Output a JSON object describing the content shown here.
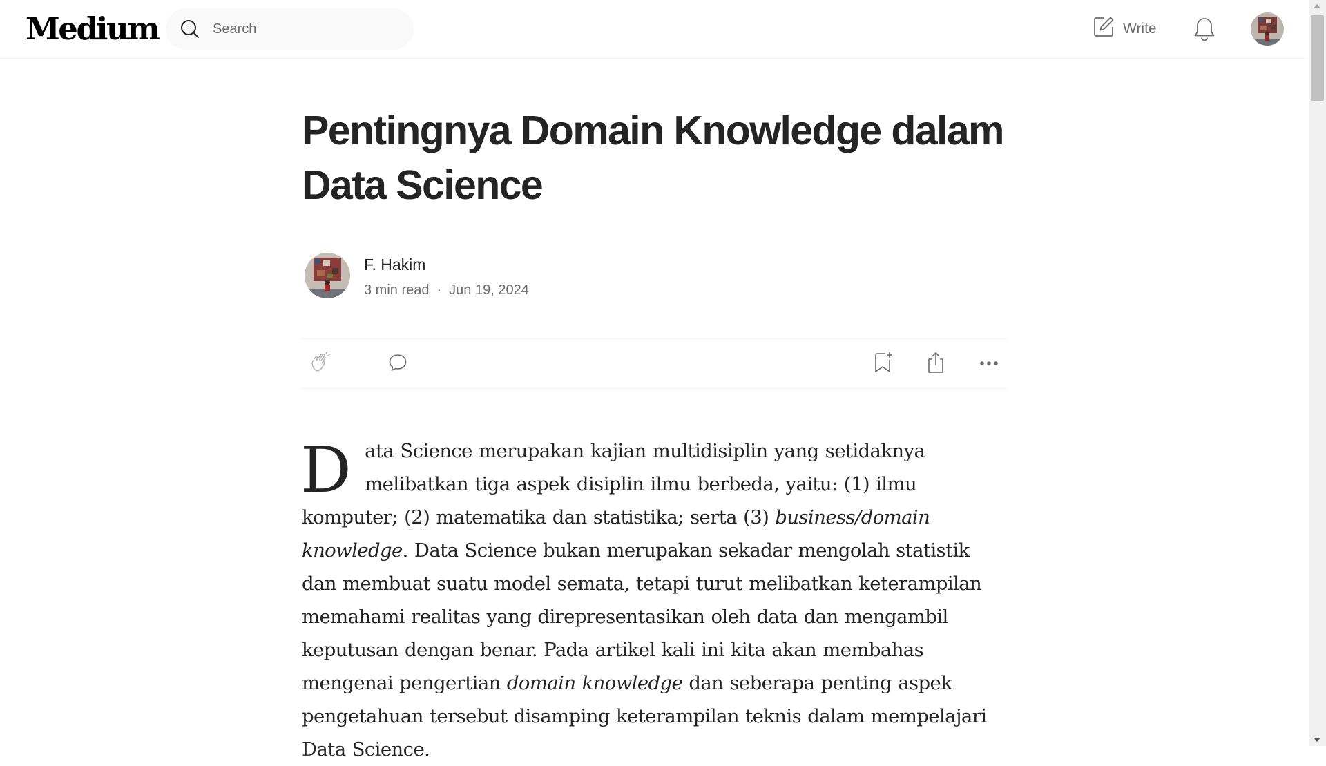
{
  "header": {
    "logo": "Medium",
    "search_placeholder": "Search",
    "write_label": "Write"
  },
  "article": {
    "title": "Pentingnya Domain Knowledge dalam Data Science",
    "author": "F. Hakim",
    "read_time": "3 min read",
    "separator": "·",
    "date": "Jun 19, 2024",
    "dropcap": "D",
    "paragraph": [
      {
        "text": "ata Science merupakan kajian multidisiplin yang setidaknya melibatkan tiga aspek disiplin ilmu berbeda, yaitu: (1) ilmu komputer; (2) matematika dan statistika; serta (3) ",
        "italic": false
      },
      {
        "text": "business/domain knowledge",
        "italic": true
      },
      {
        "text": ". Data Science bukan merupakan sekadar mengolah statistik dan membuat suatu model semata, tetapi turut melibatkan keterampilan memahami realitas yang direpresentasikan oleh data dan mengambil keputusan dengan benar. Pada artikel kali ini kita akan membahas mengenai pengertian ",
        "italic": false
      },
      {
        "text": "domain knowledge",
        "italic": true
      },
      {
        "text": " dan seberapa penting aspek pengetahuan tersebut disamping keterampilan teknis dalam mempelajari Data Science.",
        "italic": false
      }
    ]
  },
  "icons": {
    "search": "search-icon",
    "write": "edit-icon",
    "notifications": "bell-icon",
    "clap": "clap-icon",
    "comment": "comment-icon",
    "bookmark": "bookmark-add-icon",
    "share": "share-icon",
    "more": "more-icon"
  },
  "colors": {
    "text": "#242424",
    "muted": "#6b6b6b",
    "search_bg": "#f9f9f9",
    "divider": "#f2f2f2"
  }
}
